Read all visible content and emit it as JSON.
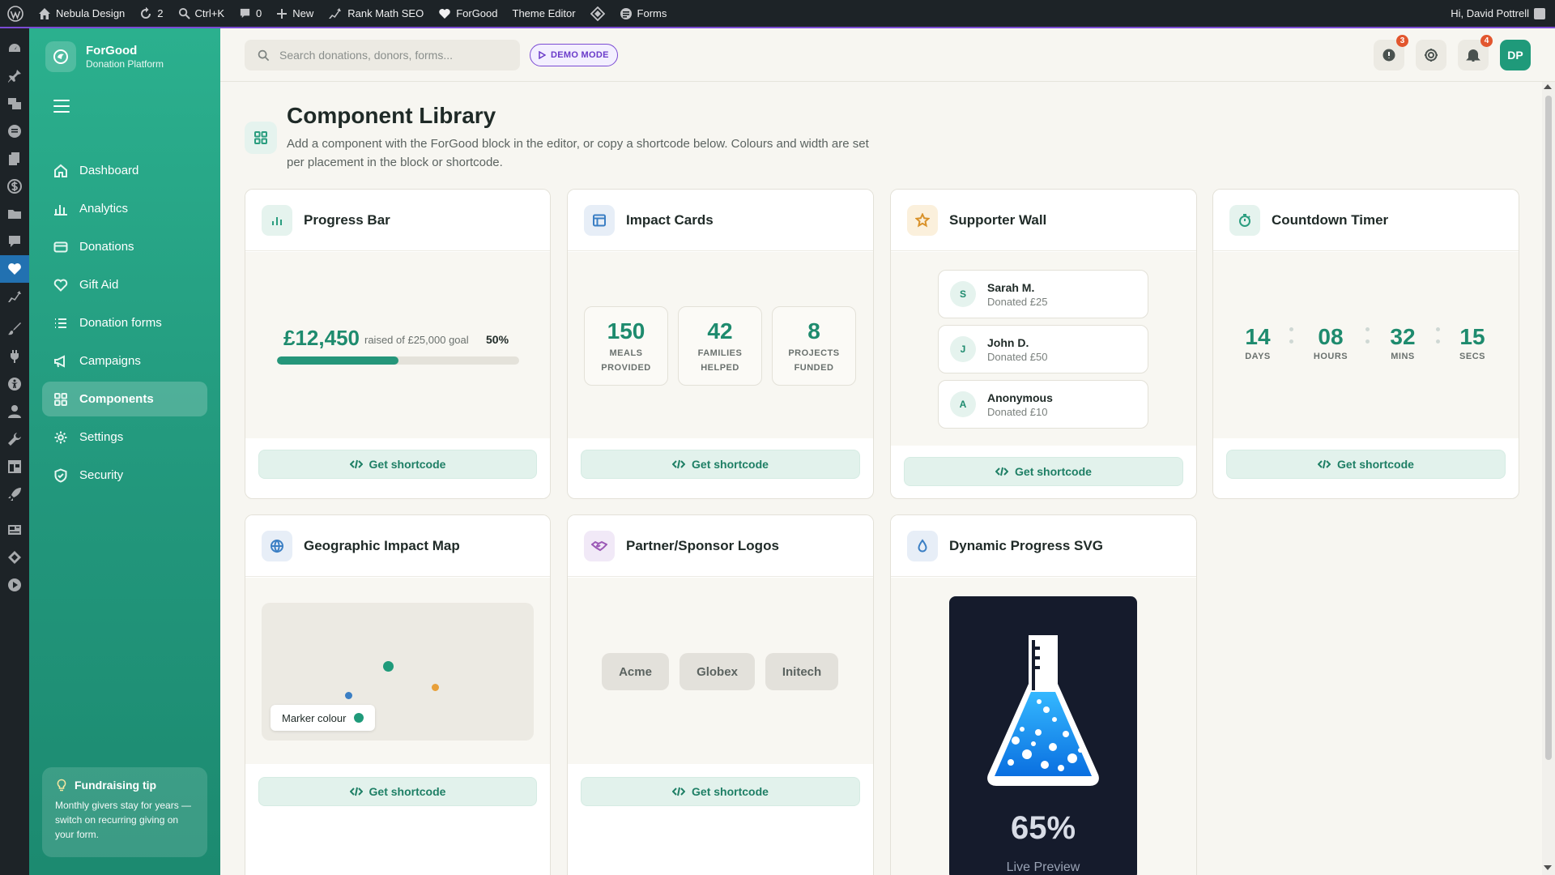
{
  "adminbar": {
    "site_name": "Nebula Design",
    "updates_count": "2",
    "search_shortcut": "Ctrl+K",
    "comments_count": "0",
    "new_label": "New",
    "rank_math_label": "Rank Math SEO",
    "forgood_label": "ForGood",
    "theme_editor_label": "Theme Editor",
    "forms_label": "Forms",
    "greeting": "Hi, David Pottrell"
  },
  "brand": {
    "name": "ForGood",
    "subtitle": "Donation Platform"
  },
  "sidebar": {
    "items": [
      {
        "label": "Dashboard",
        "icon": "home-icon"
      },
      {
        "label": "Analytics",
        "icon": "bar-chart-icon"
      },
      {
        "label": "Donations",
        "icon": "credit-card-icon"
      },
      {
        "label": "Gift Aid",
        "icon": "heart-icon"
      },
      {
        "label": "Donation forms",
        "icon": "list-icon"
      },
      {
        "label": "Campaigns",
        "icon": "megaphone-icon"
      },
      {
        "label": "Components",
        "icon": "grid-icon",
        "active": true
      },
      {
        "label": "Settings",
        "icon": "gear-icon"
      },
      {
        "label": "Security",
        "icon": "shield-icon"
      }
    ],
    "tip": {
      "title": "Fundraising tip",
      "body": "Monthly givers stay for years — switch on recurring giving on your form."
    }
  },
  "header": {
    "search_placeholder": "Search donations, donors, forms...",
    "demo_label": "DEMO MODE",
    "alerts_badge": "3",
    "notifications_badge": "4",
    "avatar_initials": "DP"
  },
  "page": {
    "title": "Component Library",
    "description": "Add a component with the ForGood block in the editor, or copy a shortcode below. Colours and width are set per placement in the block or shortcode."
  },
  "shortcode_label": "Get shortcode",
  "cards": {
    "progress": {
      "title": "Progress Bar",
      "amount": "£12,450",
      "raised_text": "raised of £25,000 goal",
      "percent_label": "50%",
      "fraction": 0.5
    },
    "impact": {
      "title": "Impact Cards",
      "stats": [
        {
          "value": "150",
          "line1": "MEALS",
          "line2": "PROVIDED"
        },
        {
          "value": "42",
          "line1": "FAMILIES",
          "line2": "HELPED"
        },
        {
          "value": "8",
          "line1": "PROJECTS",
          "line2": "FUNDED"
        }
      ]
    },
    "supporters": {
      "title": "Supporter Wall",
      "items": [
        {
          "initial": "S",
          "name": "Sarah M.",
          "amount": "Donated £25"
        },
        {
          "initial": "J",
          "name": "John D.",
          "amount": "Donated £50"
        },
        {
          "initial": "A",
          "name": "Anonymous",
          "amount": "Donated £10"
        }
      ]
    },
    "countdown": {
      "title": "Countdown Timer",
      "units": [
        {
          "value": "14",
          "label": "DAYS"
        },
        {
          "value": "08",
          "label": "HOURS"
        },
        {
          "value": "32",
          "label": "MINS"
        },
        {
          "value": "15",
          "label": "SECS"
        }
      ]
    },
    "map": {
      "title": "Geographic Impact Map",
      "marker_label": "Marker colour"
    },
    "logos": {
      "title": "Partner/Sponsor Logos",
      "items": [
        "Acme",
        "Globex",
        "Initech"
      ]
    },
    "dynamic_svg": {
      "title": "Dynamic Progress SVG",
      "percent": "65%",
      "caption": "Live Preview"
    }
  },
  "colors": {
    "brand_green": "#25967a",
    "sidebar_gradient_top": "#2bb08e",
    "demo_purple": "#7b4bd4",
    "badge_orange": "#e2562e",
    "map_marker_teal": "#1f9a7a",
    "map_marker_blue": "#3b7fc4",
    "map_marker_orange": "#e8a03a",
    "flask_blue": "#1aa3ff"
  }
}
